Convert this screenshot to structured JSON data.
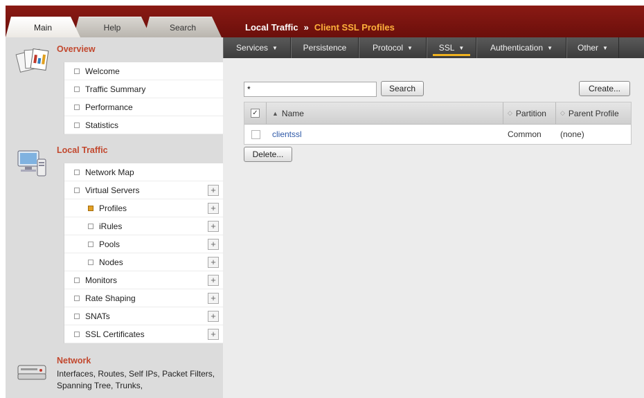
{
  "tabs": [
    {
      "label": "Main",
      "active": true
    },
    {
      "label": "Help",
      "active": false
    },
    {
      "label": "Search",
      "active": false
    }
  ],
  "breadcrumb": {
    "parent": "Local Traffic",
    "separator": "»",
    "current": "Client SSL Profiles"
  },
  "menu": [
    {
      "label": "Services",
      "dropdown": true,
      "active": false
    },
    {
      "label": "Persistence",
      "dropdown": false,
      "active": false
    },
    {
      "label": "Protocol",
      "dropdown": true,
      "active": false
    },
    {
      "label": "SSL",
      "dropdown": true,
      "active": true
    },
    {
      "label": "Authentication",
      "dropdown": true,
      "active": false
    },
    {
      "label": "Other",
      "dropdown": true,
      "active": false
    }
  ],
  "sidebar": {
    "overview": {
      "title": "Overview",
      "items": [
        "Welcome",
        "Traffic Summary",
        "Performance",
        "Statistics"
      ]
    },
    "local_traffic": {
      "title": "Local Traffic",
      "items": [
        {
          "label": "Network Map",
          "sub": false,
          "plus": false,
          "selected": false
        },
        {
          "label": "Virtual Servers",
          "sub": false,
          "plus": true,
          "selected": false
        },
        {
          "label": "Profiles",
          "sub": true,
          "plus": true,
          "selected": true
        },
        {
          "label": "iRules",
          "sub": true,
          "plus": true,
          "selected": false
        },
        {
          "label": "Pools",
          "sub": true,
          "plus": true,
          "selected": false
        },
        {
          "label": "Nodes",
          "sub": true,
          "plus": true,
          "selected": false
        },
        {
          "label": "Monitors",
          "sub": false,
          "plus": true,
          "selected": false
        },
        {
          "label": "Rate Shaping",
          "sub": false,
          "plus": true,
          "selected": false
        },
        {
          "label": "SNATs",
          "sub": false,
          "plus": true,
          "selected": false
        },
        {
          "label": "SSL Certificates",
          "sub": false,
          "plus": true,
          "selected": false
        }
      ]
    },
    "network": {
      "title": "Network",
      "description": "Interfaces, Routes, Self IPs, Packet Filters, Spanning Tree, Trunks,"
    },
    "plus_glyph": "+"
  },
  "toolbar": {
    "search_value": "*",
    "search_label": "Search",
    "create_label": "Create..."
  },
  "table": {
    "columns": [
      "Name",
      "Partition",
      "Parent Profile"
    ],
    "rows": [
      {
        "name": "clientssl",
        "partition": "Common",
        "parent": "(none)"
      }
    ]
  },
  "actions": {
    "delete_label": "Delete..."
  },
  "colors": {
    "topbar": "#7a1510",
    "accent_orange": "#ffb13b",
    "section_title": "#c2482e",
    "link": "#2d58a7",
    "menu_active_underline": "#f0b21f"
  }
}
